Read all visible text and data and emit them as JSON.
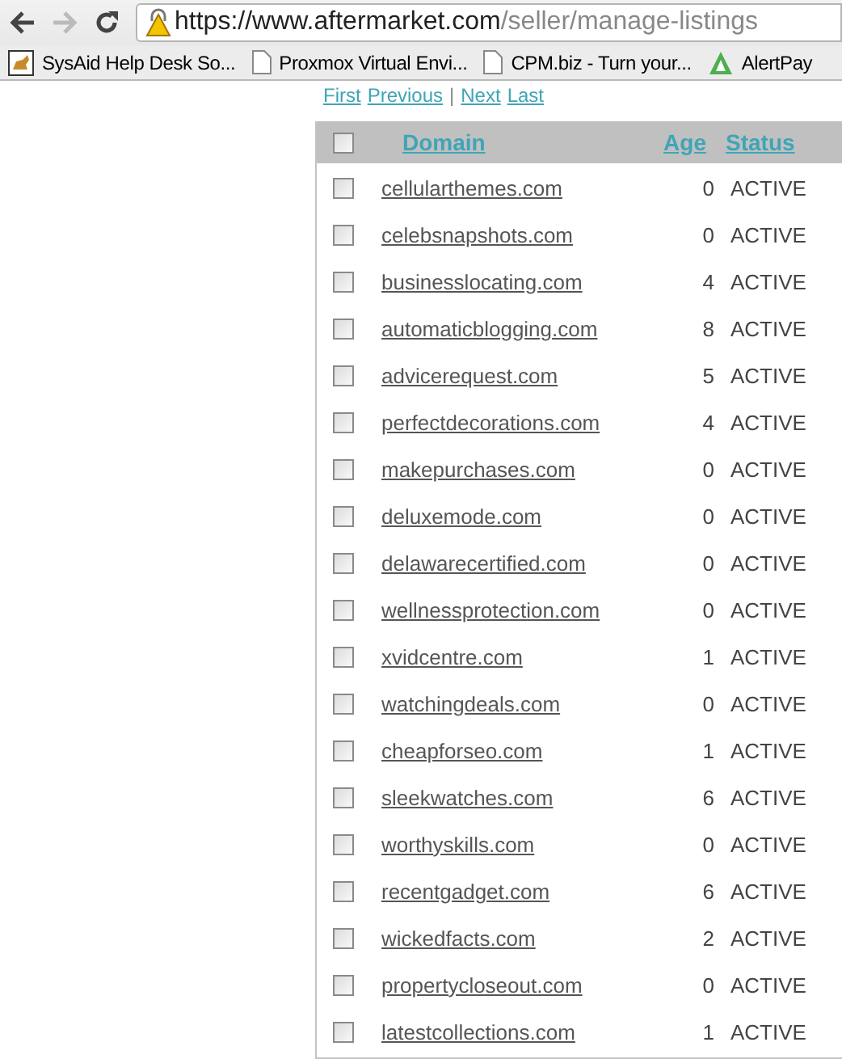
{
  "browser": {
    "url_host": "https://www.aftermarket.com",
    "url_path": "/seller/manage-listings",
    "bookmarks": [
      "SysAid Help Desk So...",
      "Proxmox Virtual Envi...",
      "CPM.biz - Turn your...",
      "AlertPay"
    ]
  },
  "pagination": [
    "First",
    "Previous",
    "|",
    "Next",
    "Last"
  ],
  "table": {
    "select_all": {
      "checked": false
    },
    "columns": [
      "Domain",
      "Age",
      "Status"
    ],
    "rows": [
      {
        "checked": false,
        "domain": "cellularthemes.com",
        "age": "0",
        "status": "ACTIVE"
      },
      {
        "checked": false,
        "domain": "celebsnapshots.com",
        "age": "0",
        "status": "ACTIVE"
      },
      {
        "checked": false,
        "domain": "businesslocating.com",
        "age": "4",
        "status": "ACTIVE"
      },
      {
        "checked": false,
        "domain": "automaticblogging.com",
        "age": "8",
        "status": "ACTIVE"
      },
      {
        "checked": false,
        "domain": "advicerequest.com",
        "age": "5",
        "status": "ACTIVE"
      },
      {
        "checked": false,
        "domain": "perfectdecorations.com",
        "age": "4",
        "status": "ACTIVE"
      },
      {
        "checked": false,
        "domain": "makepurchases.com",
        "age": "0",
        "status": "ACTIVE"
      },
      {
        "checked": false,
        "domain": "deluxemode.com",
        "age": "0",
        "status": "ACTIVE"
      },
      {
        "checked": false,
        "domain": "delawarecertified.com",
        "age": "0",
        "status": "ACTIVE"
      },
      {
        "checked": false,
        "domain": "wellnessprotection.com",
        "age": "0",
        "status": "ACTIVE"
      },
      {
        "checked": false,
        "domain": "xvidcentre.com",
        "age": "1",
        "status": "ACTIVE"
      },
      {
        "checked": false,
        "domain": "watchingdeals.com",
        "age": "0",
        "status": "ACTIVE"
      },
      {
        "checked": false,
        "domain": "cheapforseo.com",
        "age": "1",
        "status": "ACTIVE"
      },
      {
        "checked": false,
        "domain": "sleekwatches.com",
        "age": "6",
        "status": "ACTIVE"
      },
      {
        "checked": false,
        "domain": "worthyskills.com",
        "age": "0",
        "status": "ACTIVE"
      },
      {
        "checked": false,
        "domain": "recentgadget.com",
        "age": "6",
        "status": "ACTIVE"
      },
      {
        "checked": false,
        "domain": "wickedfacts.com",
        "age": "2",
        "status": "ACTIVE"
      },
      {
        "checked": false,
        "domain": "propertycloseout.com",
        "age": "0",
        "status": "ACTIVE"
      },
      {
        "checked": false,
        "domain": "latestcollections.com",
        "age": "1",
        "status": "ACTIVE"
      }
    ]
  }
}
